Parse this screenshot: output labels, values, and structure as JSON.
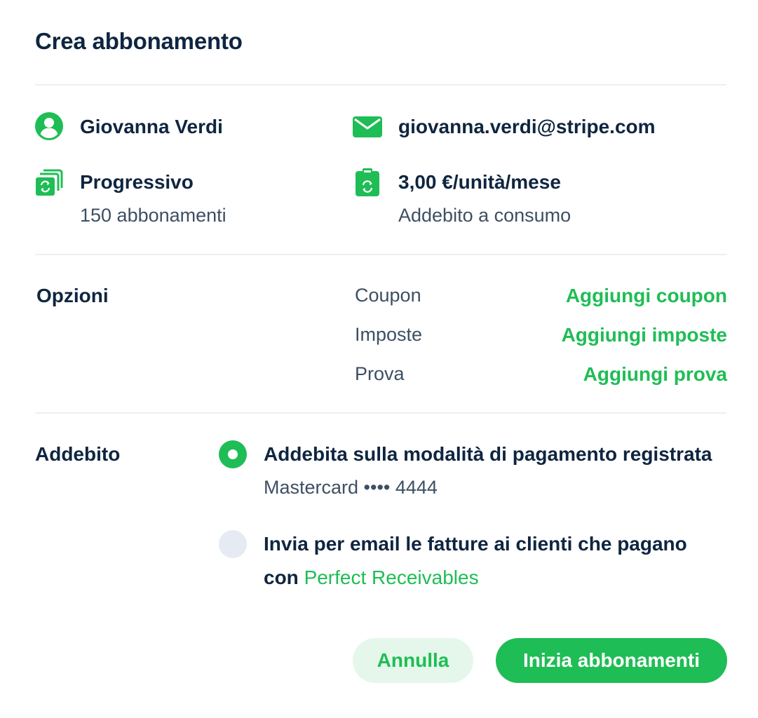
{
  "dialog": {
    "title": "Crea abbonamento"
  },
  "customer": {
    "name": "Giovanna Verdi",
    "name_icon": "user-icon",
    "email": "giovanna.verdi@stripe.com",
    "email_icon": "mail-icon"
  },
  "plan": {
    "name": "Progressivo",
    "count": "150 abbonamenti",
    "plan_icon": "subscriptions-icon",
    "price": "3,00 €/unità/mese",
    "billing_type": "Addebito a consumo",
    "price_icon": "recurring-billing-icon"
  },
  "options": {
    "heading": "Opzioni",
    "rows": [
      {
        "label": "Coupon",
        "action": "Aggiungi coupon"
      },
      {
        "label": "Imposte",
        "action": "Aggiungi imposte"
      },
      {
        "label": "Prova",
        "action": "Aggiungi prova"
      }
    ]
  },
  "billing": {
    "heading": "Addebito",
    "option1": {
      "label": "Addebita sulla modalità di pagamento registrata",
      "detail": "Mastercard •••• 4444",
      "selected": true
    },
    "option2": {
      "label_line1": "Invia per email le fatture ai clienti che pagano",
      "label_prefix": "con ",
      "label_link": "Perfect Receivables",
      "selected": false
    }
  },
  "actions": {
    "cancel_label": "Annulla",
    "submit_label": "Inizia abbonamenti"
  },
  "colors": {
    "accent": "#1fbd55",
    "text": "#0f2540",
    "muted": "#3d4f63",
    "divider": "#eceff3"
  }
}
